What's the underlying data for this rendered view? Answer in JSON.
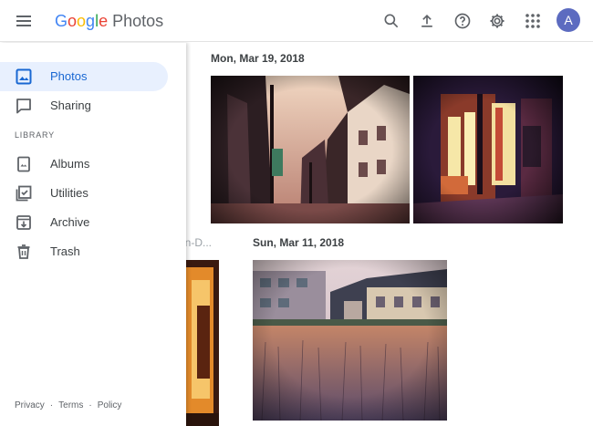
{
  "header": {
    "logo_letters": [
      {
        "ch": "G",
        "color": "#4285F4"
      },
      {
        "ch": "o",
        "color": "#EA4335"
      },
      {
        "ch": "o",
        "color": "#FBBC05"
      },
      {
        "ch": "g",
        "color": "#4285F4"
      },
      {
        "ch": "l",
        "color": "#34A853"
      },
      {
        "ch": "e",
        "color": "#EA4335"
      }
    ],
    "product_name": "Photos",
    "avatar_letter": "A",
    "avatar_color": "#5c6bc0",
    "icons": [
      "menu-icon",
      "search-icon",
      "upload-icon",
      "help-icon",
      "settings-icon",
      "apps-icon"
    ]
  },
  "sidebar": {
    "items": [
      {
        "label": "Photos",
        "icon": "photos-icon",
        "active": true
      },
      {
        "label": "Sharing",
        "icon": "sharing-icon",
        "active": false
      }
    ],
    "library_label": "LIBRARY",
    "library_items": [
      {
        "label": "Albums",
        "icon": "albums-icon"
      },
      {
        "label": "Utilities",
        "icon": "utilities-icon"
      },
      {
        "label": "Archive",
        "icon": "archive-icon"
      },
      {
        "label": "Trash",
        "icon": "trash-icon"
      }
    ],
    "footer": {
      "privacy": "Privacy",
      "sep1": "·",
      "terms": "Terms",
      "sep2": "·",
      "policy": "Policy"
    },
    "accent_color": "#1967d2",
    "active_bg": "#e8f0fe"
  },
  "main": {
    "groups": [
      {
        "date": "Mon, Mar 19, 2018"
      },
      {
        "date": "Sun, Mar 11, 2018"
      }
    ],
    "partial_label": "on-D..."
  }
}
